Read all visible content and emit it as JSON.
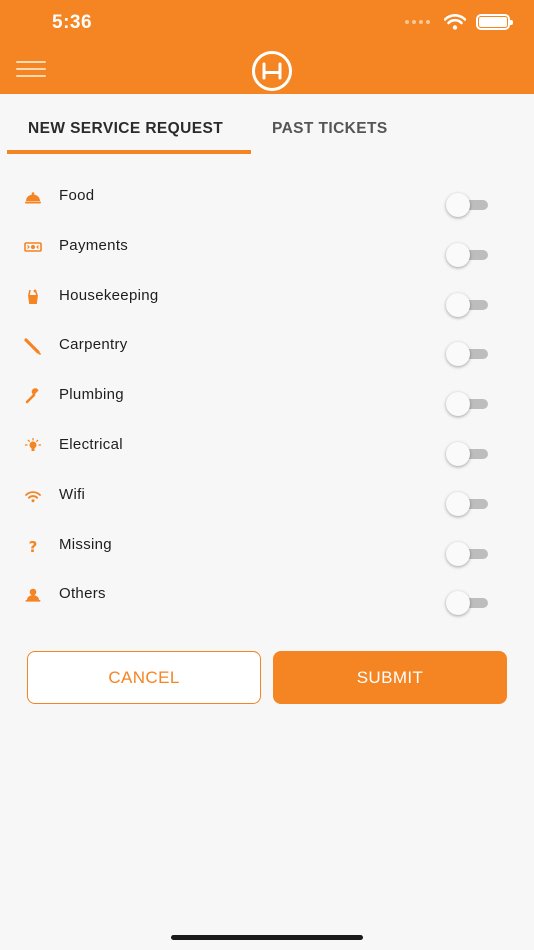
{
  "status_bar": {
    "time": "5:36"
  },
  "tabs": [
    {
      "label": "NEW SERVICE REQUEST",
      "active": true
    },
    {
      "label": "PAST TICKETS",
      "active": false
    }
  ],
  "services": [
    {
      "label": "Food",
      "icon": "food-cloche-icon",
      "enabled": false
    },
    {
      "label": "Payments",
      "icon": "payments-ticket-icon",
      "enabled": false
    },
    {
      "label": "Housekeeping",
      "icon": "housekeeping-bucket-icon",
      "enabled": false
    },
    {
      "label": "Carpentry",
      "icon": "carpentry-saw-icon",
      "enabled": false
    },
    {
      "label": "Plumbing",
      "icon": "plumbing-wrench-icon",
      "enabled": false
    },
    {
      "label": "Electrical",
      "icon": "electrical-bulb-icon",
      "enabled": false
    },
    {
      "label": "Wifi",
      "icon": "wifi-icon",
      "enabled": false
    },
    {
      "label": "Missing",
      "icon": "question-mark-icon",
      "enabled": false
    },
    {
      "label": "Others",
      "icon": "others-person-icon",
      "enabled": false
    }
  ],
  "actions": {
    "cancel_label": "CANCEL",
    "submit_label": "SUBMIT"
  },
  "colors": {
    "accent": "#f58422",
    "toggle_track_off": "#bdbdbd"
  }
}
